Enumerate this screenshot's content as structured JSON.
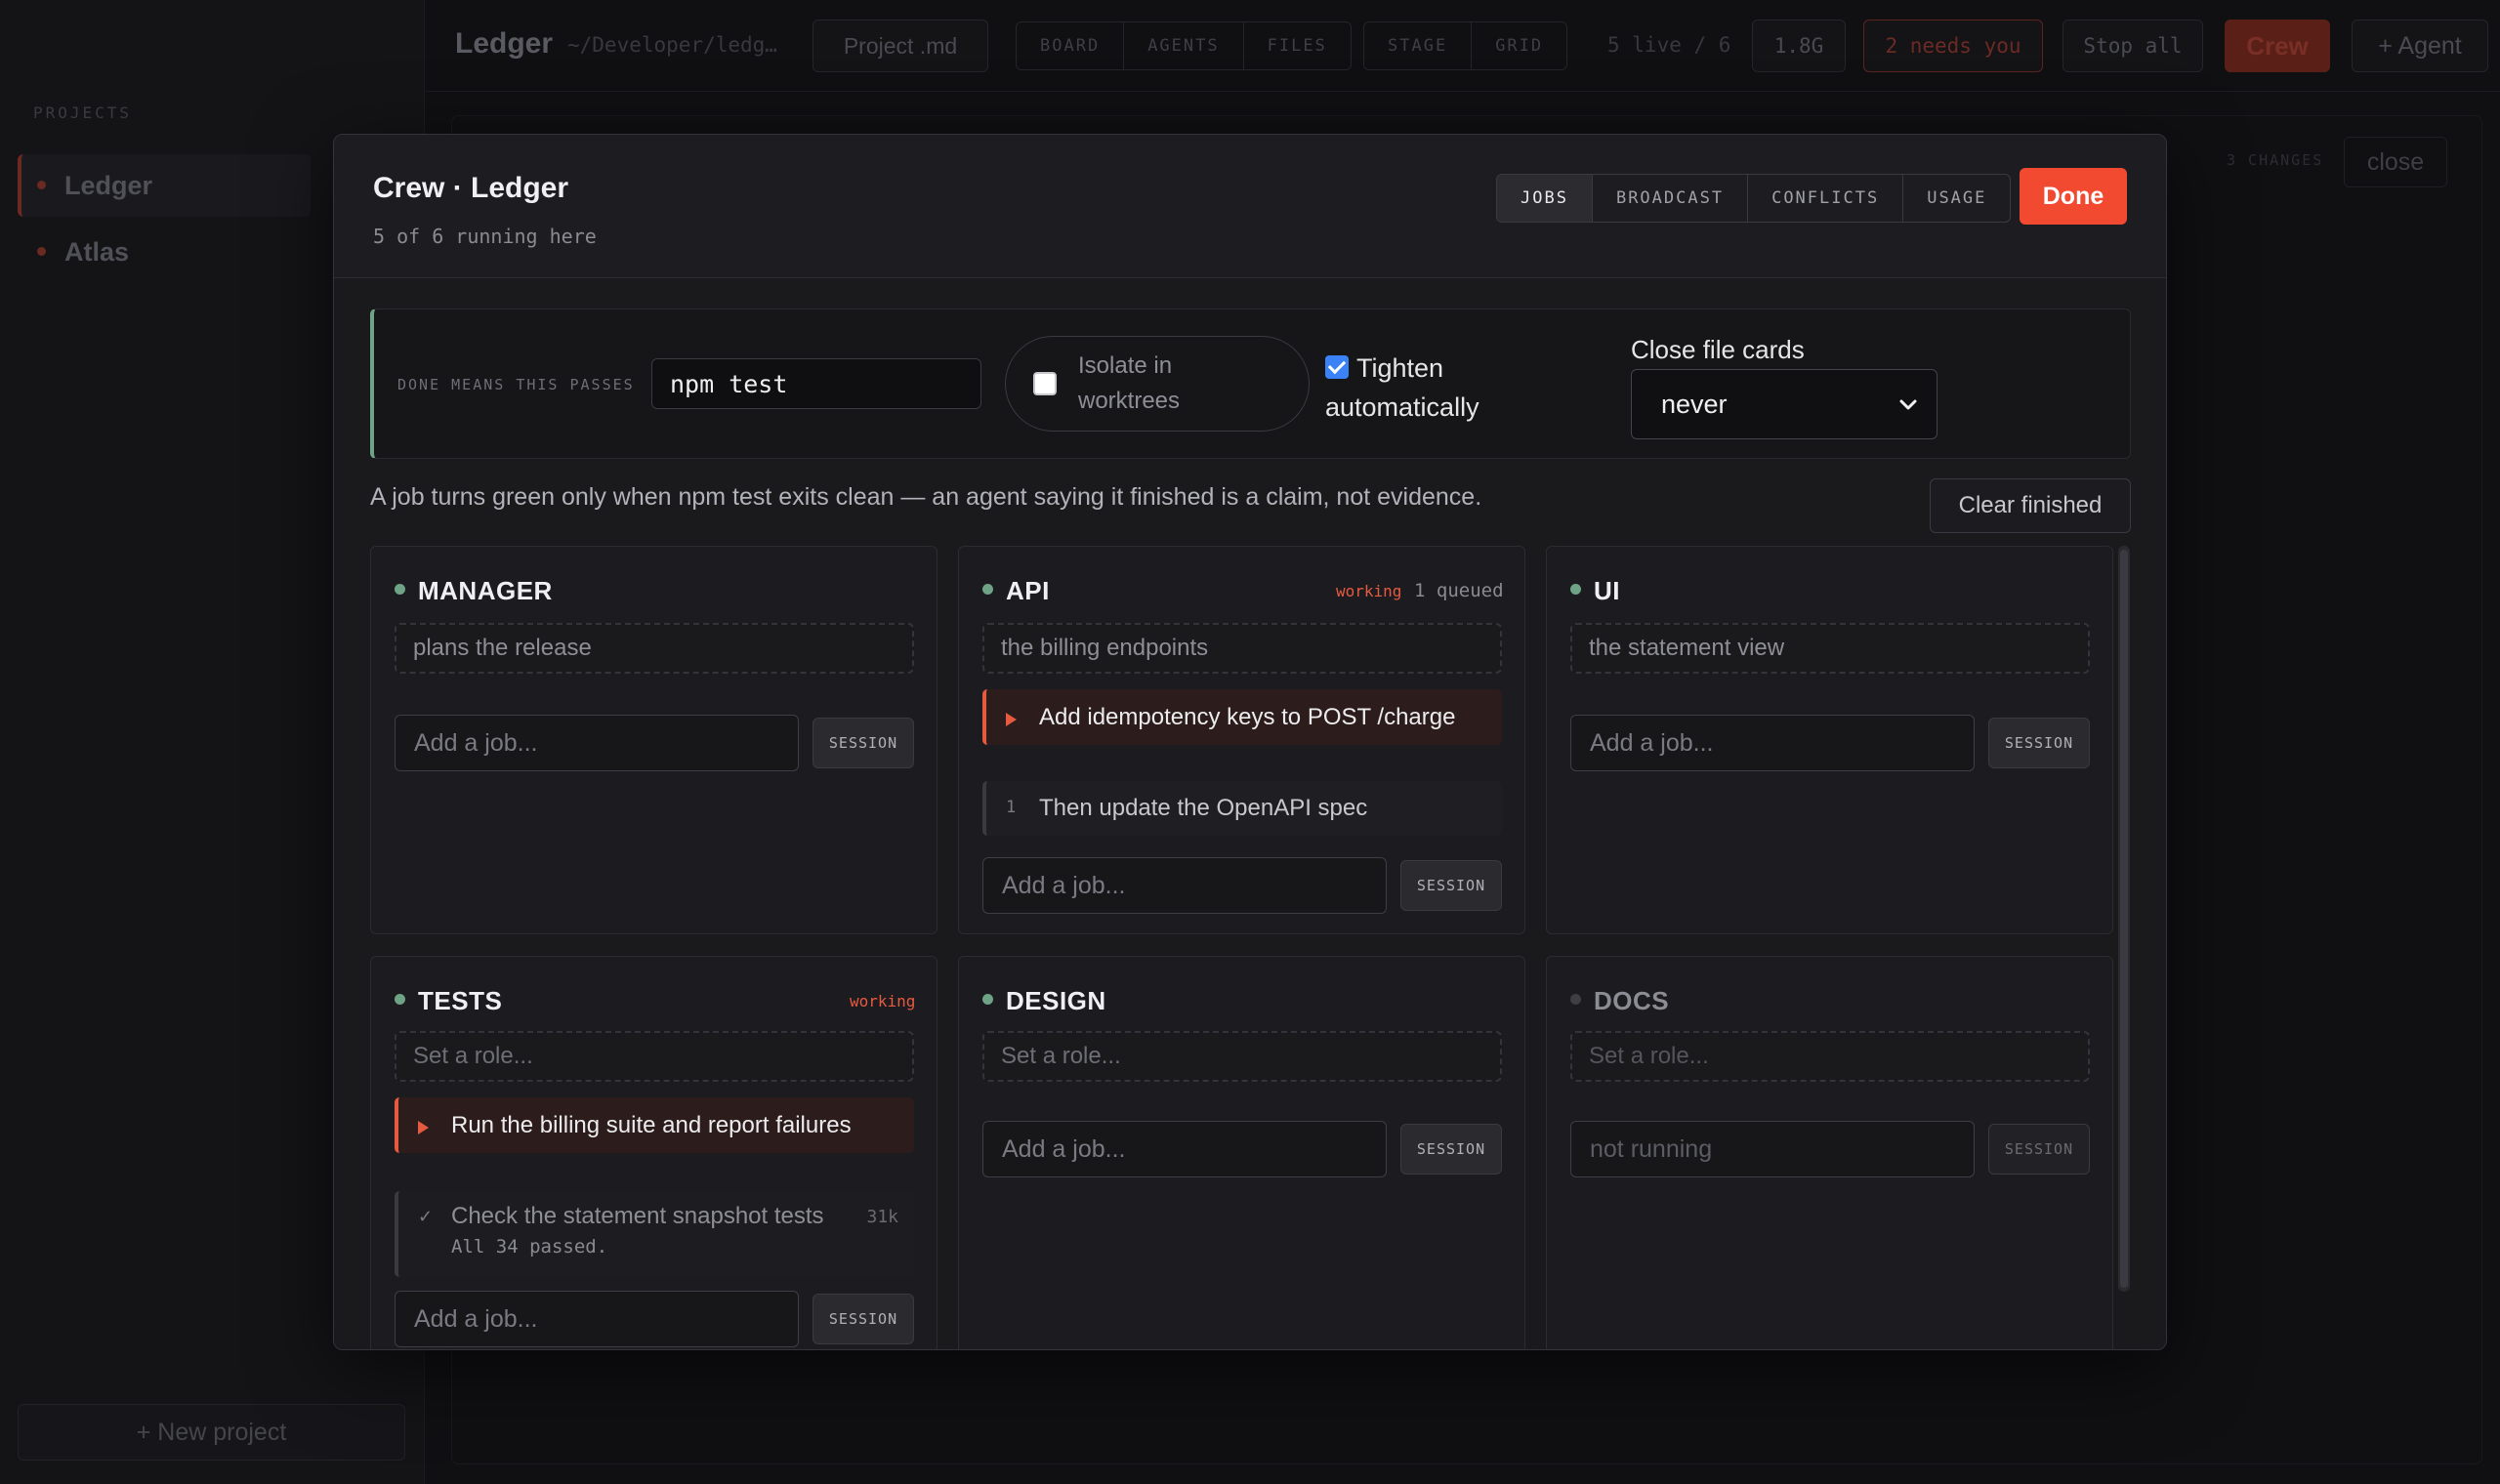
{
  "app": {
    "title": "Ledger",
    "path": "~/Developer/ledg…",
    "project_file": "Project .md",
    "view_tabs": [
      "BOARD",
      "AGENTS",
      "FILES"
    ],
    "layout_tabs": [
      "STAGE",
      "GRID"
    ],
    "live_count": "5 live / 6",
    "memory": "1.8G",
    "needs_you": "2 needs you",
    "stop_all": "Stop all",
    "crew": "Crew",
    "add_agent": "+ Agent",
    "changes_label": "3 CHANGES",
    "close_label": "close"
  },
  "sidebar": {
    "heading": "PROJECTS",
    "projects": [
      {
        "name": "Ledger",
        "active": true
      },
      {
        "name": "Atlas",
        "active": false
      }
    ],
    "new_project": "+ New project"
  },
  "modal": {
    "title": "Crew · Ledger",
    "subtitle": "5 of 6 running here",
    "tabs": [
      "JOBS",
      "BROADCAST",
      "CONFLICTS",
      "USAGE"
    ],
    "active_tab": "JOBS",
    "done_label": "Done",
    "settings": {
      "done_means_label": "DONE MEANS THIS PASSES",
      "command": "npm test",
      "isolate_label": "Isolate in worktrees",
      "isolate_checked": false,
      "tighten_label": "Tighten automatically",
      "tighten_checked": true,
      "close_cards_label": "Close file cards",
      "close_cards_value": "never"
    },
    "info": "A job turns green only when npm test exits clean — an agent saying it finished is a claim, not evidence.",
    "clear_finished": "Clear finished",
    "session_label": "SESSION",
    "add_job_placeholder": "Add a job...",
    "agents": [
      {
        "name": "MANAGER",
        "role": "plans the release",
        "running": true
      },
      {
        "name": "API",
        "role": "the billing endpoints",
        "running": true,
        "status": "working",
        "queued": "1 queued",
        "active_job": "Add idempotency keys to POST /charge",
        "queued_job": {
          "index": "1",
          "text": "Then update the OpenAPI spec"
        }
      },
      {
        "name": "UI",
        "role": "the statement view",
        "running": true
      },
      {
        "name": "TESTS",
        "role_placeholder": "Set a role...",
        "running": true,
        "status": "working",
        "active_job": "Run the billing suite and report failures",
        "done_job": {
          "text": "Check the statement snapshot tests",
          "size": "31k",
          "note": "All 34 passed."
        }
      },
      {
        "name": "DESIGN",
        "role_placeholder": "Set a role...",
        "running": true
      },
      {
        "name": "DOCS",
        "role_placeholder": "Set a role...",
        "running": false,
        "job_placeholder": "not running"
      }
    ]
  },
  "colors": {
    "accent": "#f24a30",
    "running_dot": "#6fa386",
    "working": "#e65a40",
    "checkbox": "#3b82f6"
  }
}
